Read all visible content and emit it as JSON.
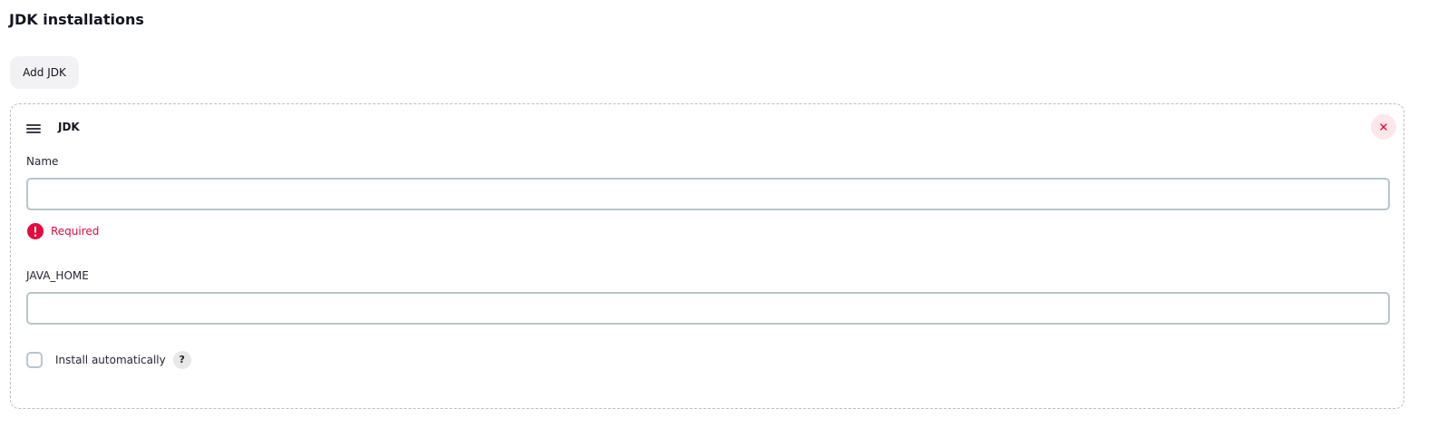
{
  "section": {
    "title": "JDK installations",
    "add_button_label": "Add JDK"
  },
  "jdk_entry": {
    "title": "JDK",
    "name": {
      "label": "Name",
      "value": "",
      "placeholder": "",
      "validation_message": "Required"
    },
    "java_home": {
      "label": "JAVA_HOME",
      "value": "",
      "placeholder": ""
    },
    "install_automatically": {
      "label": "Install automatically",
      "checked": false,
      "help_label": "?"
    }
  },
  "icons": {
    "drag": "drag-handle-icon",
    "delete": "close-icon",
    "validation": "error-icon",
    "help": "help-icon"
  },
  "colors": {
    "error": "#e5093d",
    "delete_background": "#fde7eb",
    "input_border": "#b9c5ca",
    "button_background": "#f2f2f4"
  }
}
